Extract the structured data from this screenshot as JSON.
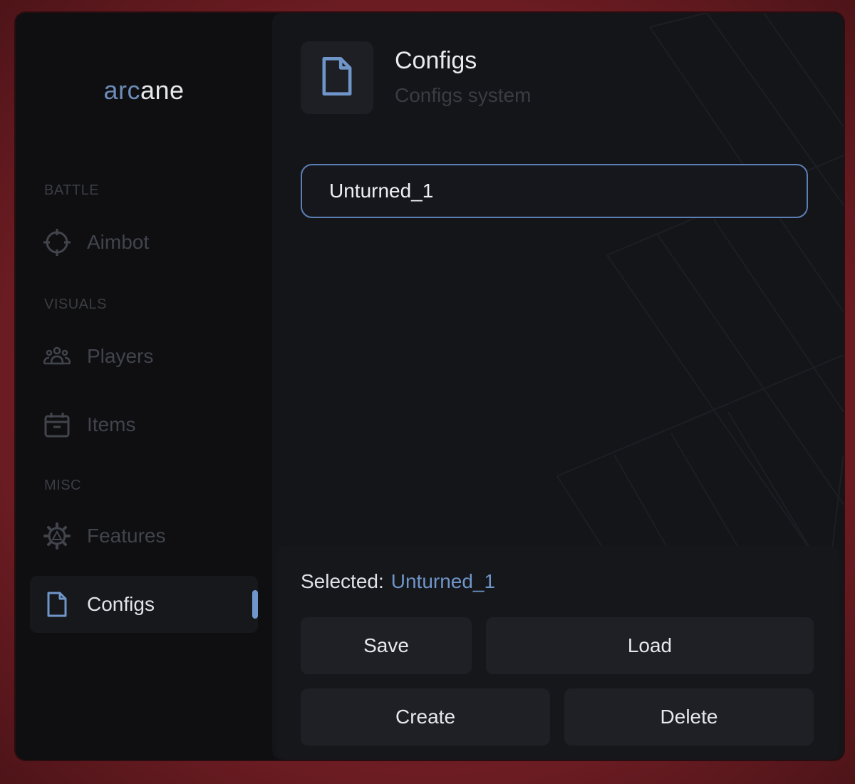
{
  "app": {
    "logo_prefix": "arc",
    "logo_suffix": "ane"
  },
  "sidebar": {
    "sections": [
      {
        "label": "BATTLE"
      },
      {
        "label": "VISUALS"
      },
      {
        "label": "MISC"
      }
    ],
    "items": [
      {
        "label": "Aimbot",
        "icon": "crosshair-icon"
      },
      {
        "label": "Players",
        "icon": "users-icon"
      },
      {
        "label": "Items",
        "icon": "box-icon"
      },
      {
        "label": "Features",
        "icon": "gear-icon"
      },
      {
        "label": "Configs",
        "icon": "file-icon",
        "active": true
      }
    ]
  },
  "main": {
    "title": "Configs",
    "subtitle": "Configs system",
    "config_name": "Unturned_1",
    "selected_label": "Selected:",
    "selected_value": "Unturned_1",
    "buttons": {
      "save": "Save",
      "load": "Load",
      "create": "Create",
      "delete": "Delete"
    }
  },
  "colors": {
    "accent": "#6f95c9",
    "background": "#0f0f11",
    "panel": "#141519",
    "button": "#1f2025",
    "muted_text": "#41444c"
  }
}
